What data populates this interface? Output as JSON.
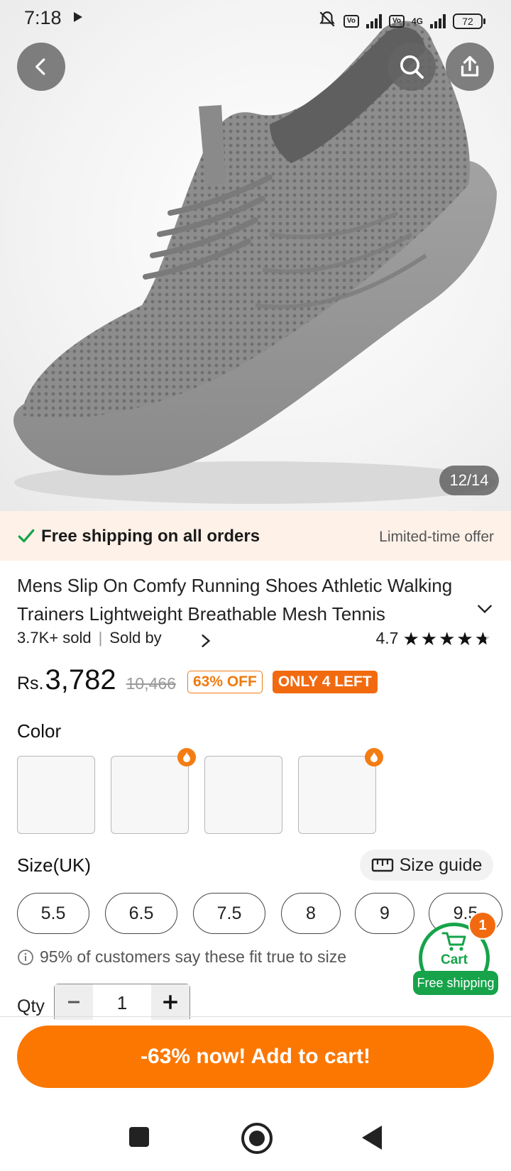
{
  "status_bar": {
    "time": "7:18",
    "battery": "72",
    "net_label": "4G"
  },
  "gallery": {
    "counter": "12/14",
    "product_image": "grey-knit-sneaker"
  },
  "shipping_banner": {
    "text": "Free shipping on all orders",
    "offer": "Limited-time offer"
  },
  "product": {
    "title": "Mens Slip On Comfy Running Shoes Athletic Walking Trainers Lightweight Breathable Mesh Tennis",
    "sold": "3.7K+ sold",
    "sold_by": "Sold by",
    "rating": "4.7"
  },
  "price": {
    "currency": "Rs.",
    "current": "3,782",
    "original": "10,466",
    "discount": "63% OFF",
    "stock": "ONLY 4 LEFT"
  },
  "color": {
    "label": "Color"
  },
  "size": {
    "label": "Size(UK)",
    "guide": "Size guide",
    "options": [
      "5.5",
      "6.5",
      "7.5",
      "8",
      "9",
      "9.5"
    ],
    "fit_note": "95% of customers say these fit true to size"
  },
  "qty": {
    "label": "Qty",
    "value": "1"
  },
  "cart": {
    "label": "Cart",
    "count": "1",
    "free_shipping": "Free shipping"
  },
  "add_to_cart": "-63% now! Add to cart!",
  "colors": {
    "accent": "#fb7701",
    "green": "#16a34a",
    "banner_bg": "#fdf1e8"
  }
}
